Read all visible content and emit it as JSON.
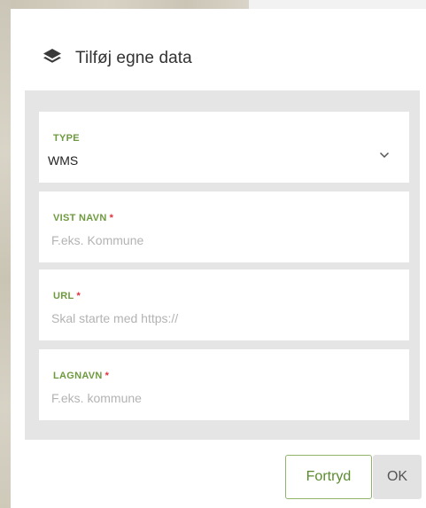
{
  "dialog": {
    "title": "Tilføj egne data",
    "icon": "layers-icon"
  },
  "fields": {
    "type": {
      "label": "TYPE",
      "value": "WMS"
    },
    "display_name": {
      "label": "VIST NAVN",
      "required_mark": "*",
      "placeholder": "F.eks. Kommune"
    },
    "url": {
      "label": "URL",
      "required_mark": "*",
      "placeholder": "Skal starte med https://"
    },
    "layer_name": {
      "label": "LAGNAVN",
      "required_mark": "*",
      "placeholder": "F.eks. kommune"
    }
  },
  "buttons": {
    "cancel_label": "Fortryd",
    "ok_label": "OK"
  },
  "colors": {
    "label_green": "#6e9a3f",
    "required_red": "#e0303a",
    "panel_gray": "#e5e5e5",
    "cancel_border": "#8fb46a"
  }
}
